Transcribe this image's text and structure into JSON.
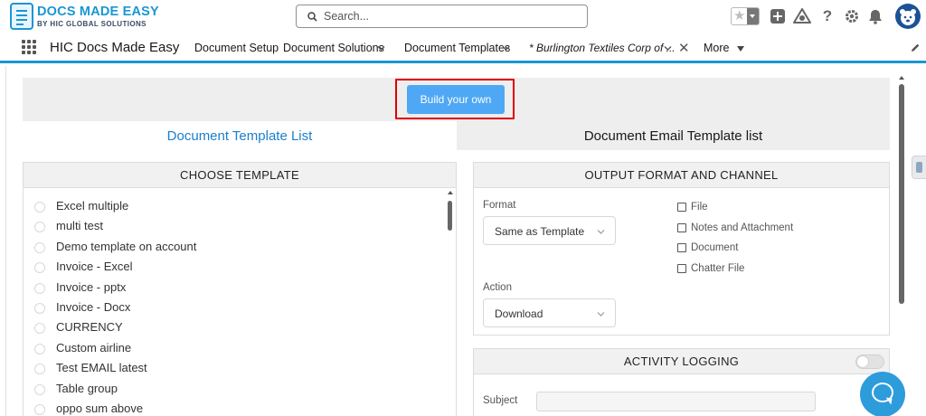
{
  "header": {
    "logo_title": "DOCS MADE EASY",
    "logo_subtitle": "BY HIC GLOBAL SOLUTIONS",
    "search_placeholder": "Search...",
    "icons": [
      "favorites-star-icon",
      "global-actions-add-icon",
      "trailhead-guide-icon",
      "help-icon",
      "settings-gear-icon",
      "notifications-bell-icon",
      "user-avatar"
    ]
  },
  "nav": {
    "app_name": "HIC Docs Made Easy",
    "items": [
      {
        "label": "Document Setup"
      },
      {
        "label": "Document Solutions"
      },
      {
        "label": "Document Templates"
      },
      {
        "label": "* Burlington Textiles Corp of ..."
      },
      {
        "label": "More"
      }
    ]
  },
  "main": {
    "build_button": "Build your own",
    "tabs": [
      {
        "label": "Document Template List",
        "active": true
      },
      {
        "label": "Document Email Template list",
        "active": false
      }
    ],
    "choose_template": {
      "heading": "CHOOSE TEMPLATE",
      "items": [
        "Excel multiple",
        "multi test",
        "Demo template on account",
        "Invoice - Excel",
        "Invoice - pptx",
        "Invoice - Docx",
        "CURRENCY",
        "Custom airline",
        "Test EMAIL latest",
        "Table group",
        "oppo sum above"
      ]
    },
    "output": {
      "heading": "OUTPUT FORMAT AND CHANNEL",
      "format_label": "Format",
      "format_value": "Same as Template",
      "action_label": "Action",
      "action_value": "Download",
      "channels": [
        "File",
        "Notes and Attachment",
        "Document",
        "Chatter File"
      ]
    },
    "activity": {
      "heading": "ACTIVITY LOGGING",
      "subject_label": "Subject",
      "logging_enabled": false
    }
  },
  "colors": {
    "brand": "#1b96d3",
    "button": "#4fa8f5",
    "highlight": "#e00000",
    "chat": "#2d9cdb"
  }
}
